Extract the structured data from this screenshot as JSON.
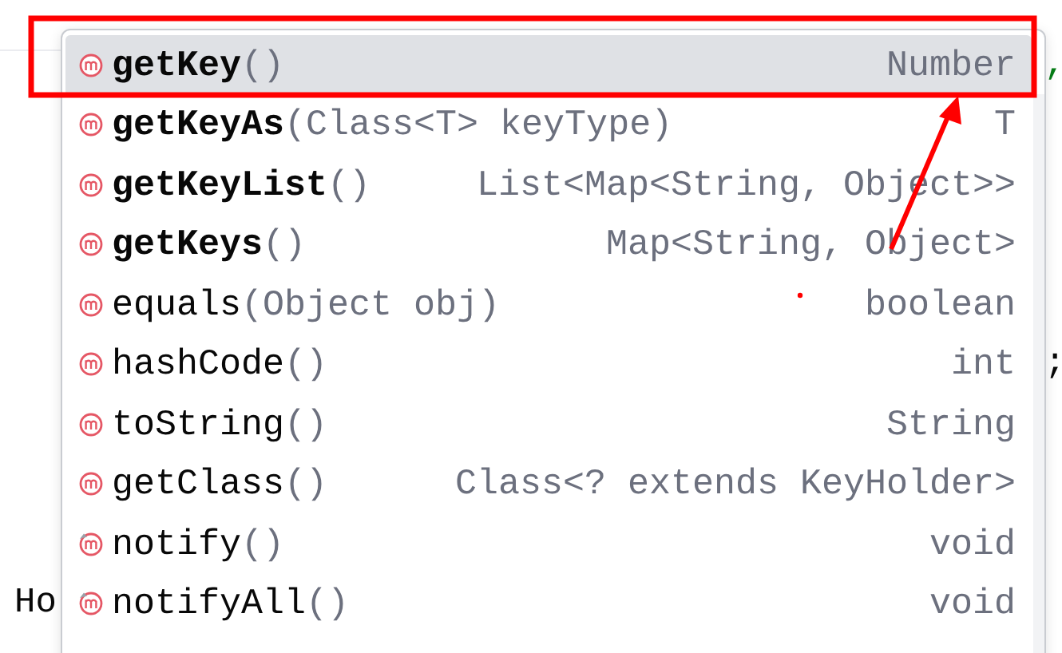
{
  "editor": {
    "line_end_top": ",",
    "line_end_bottom": ";",
    "left_fragment": "Ho"
  },
  "completion": {
    "items": [
      {
        "name": "getKey",
        "params": "()",
        "type": "Number",
        "bold": true,
        "selected": true,
        "final": false
      },
      {
        "name": "getKeyAs",
        "params": "(Class<T> keyType)",
        "type": "T",
        "bold": true,
        "selected": false,
        "final": false
      },
      {
        "name": "getKeyList",
        "params": "()",
        "type": "List<Map<String, Object>>",
        "bold": true,
        "selected": false,
        "final": false
      },
      {
        "name": "getKeys",
        "params": "()",
        "type": "Map<String, Object>",
        "bold": true,
        "selected": false,
        "final": false
      },
      {
        "name": "equals",
        "params": "(Object obj)",
        "type": "boolean",
        "bold": false,
        "selected": false,
        "final": false
      },
      {
        "name": "hashCode",
        "params": "()",
        "type": "int",
        "bold": false,
        "selected": false,
        "final": false
      },
      {
        "name": "toString",
        "params": "()",
        "type": "String",
        "bold": false,
        "selected": false,
        "final": false
      },
      {
        "name": "getClass",
        "params": "()",
        "type": "Class<? extends KeyHolder>",
        "bold": false,
        "selected": false,
        "final": false
      },
      {
        "name": "notify",
        "params": "()",
        "type": "void",
        "bold": false,
        "selected": false,
        "final": true
      },
      {
        "name": "notifyAll",
        "params": "()",
        "type": "void",
        "bold": false,
        "selected": false,
        "final": true
      }
    ]
  }
}
